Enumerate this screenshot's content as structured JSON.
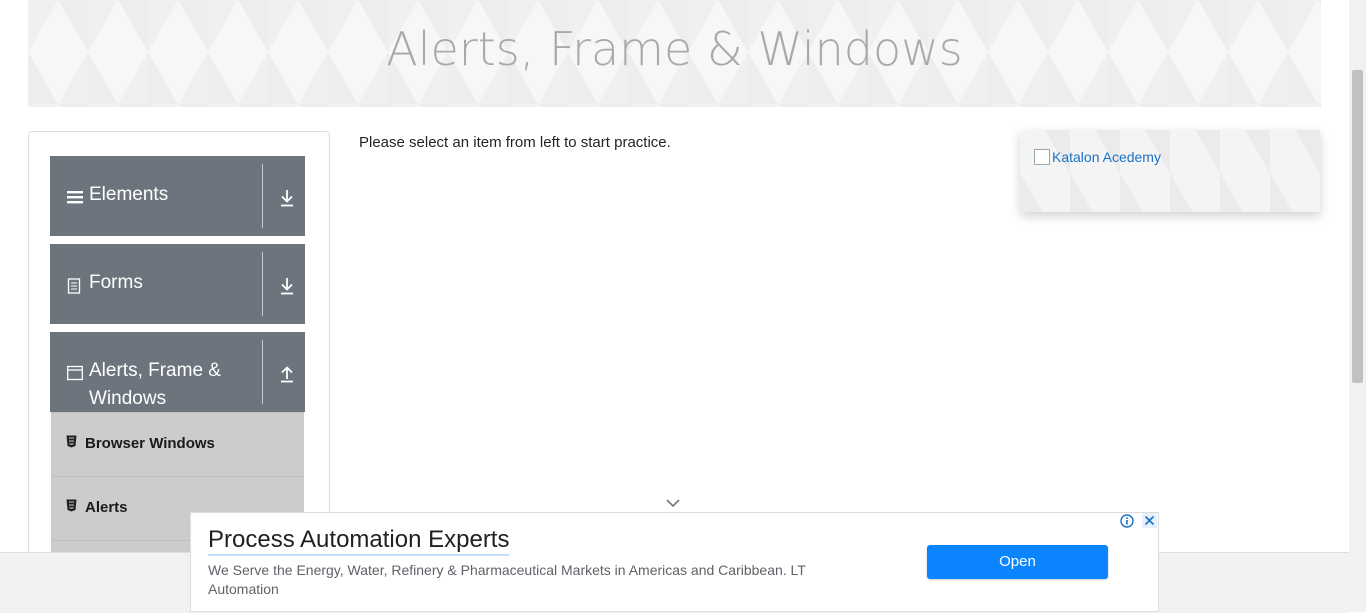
{
  "page": {
    "title": "Alerts, Frame & Windows"
  },
  "sidebar": {
    "groups": [
      {
        "label": "Elements",
        "icon": "hamburger-icon",
        "state": "collapsed"
      },
      {
        "label": "Forms",
        "icon": "document-icon",
        "state": "collapsed"
      },
      {
        "label": "Alerts, Frame & Windows",
        "icon": "window-icon",
        "state": "expanded"
      }
    ],
    "subitems": [
      {
        "label": "Browser Windows",
        "icon": "html5-icon"
      },
      {
        "label": "Alerts",
        "icon": "html5-icon"
      }
    ]
  },
  "main": {
    "instruction": "Please select an item from left to start practice."
  },
  "side_ad": {
    "alt_text": "Katalon Acedemy"
  },
  "ad_banner": {
    "title": "Process Automation Experts",
    "description": "We Serve the Energy, Water, Refinery & Pharmaceutical Markets in Americas and Caribbean. LT Automation",
    "button": "Open"
  },
  "colors": {
    "group_bg": "#6c757d",
    "subitem_bg": "#cccccc",
    "open_button": "#0a84ff",
    "link": "#1a73c8"
  }
}
